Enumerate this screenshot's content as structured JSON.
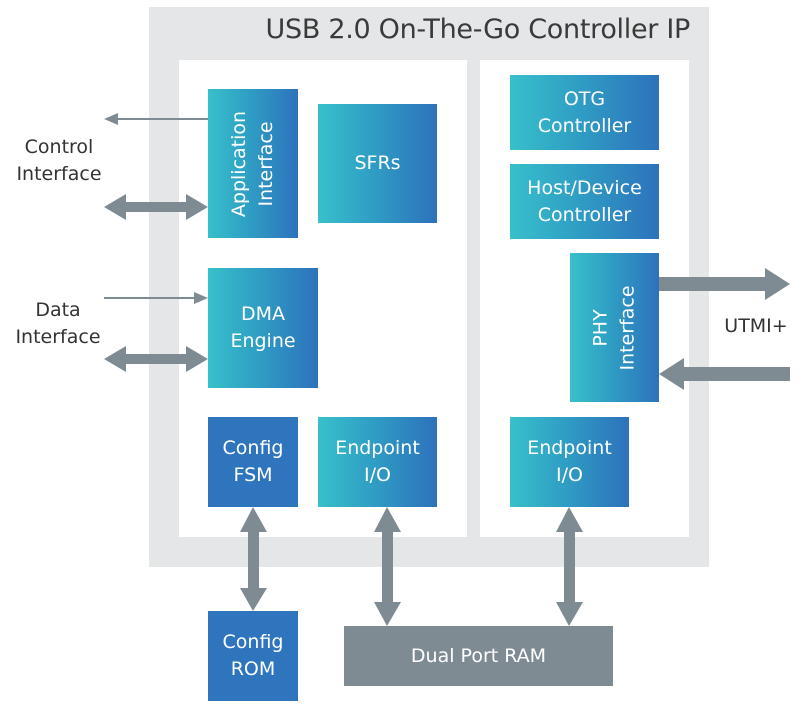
{
  "title": "USB 2.0 On-The-Go Controller IP",
  "external_labels": {
    "control_interface": "Control\nInterface",
    "data_interface": "Data\nInterface",
    "utmi": "UTMI+"
  },
  "blocks": {
    "application_interface": "Application\nInterface",
    "sfrs": "SFRs",
    "dma_engine": "DMA\nEngine",
    "config_fsm": "Config\nFSM",
    "endpoint_io_left": "Endpoint\nI/O",
    "otg_controller": "OTG\nController",
    "host_device_controller": "Host/Device\nController",
    "phy_interface": "PHY\nInterface",
    "endpoint_io_right": "Endpoint\nI/O",
    "config_rom": "Config\nROM",
    "dual_port_ram": "Dual Port RAM"
  },
  "colors": {
    "frame": "#e5e6e8",
    "gradient_start": "#38c0cb",
    "gradient_end": "#2e72bc",
    "solid_blue": "#2e75be",
    "arrow_gray": "#7f8b93",
    "text_dark": "#333333"
  }
}
